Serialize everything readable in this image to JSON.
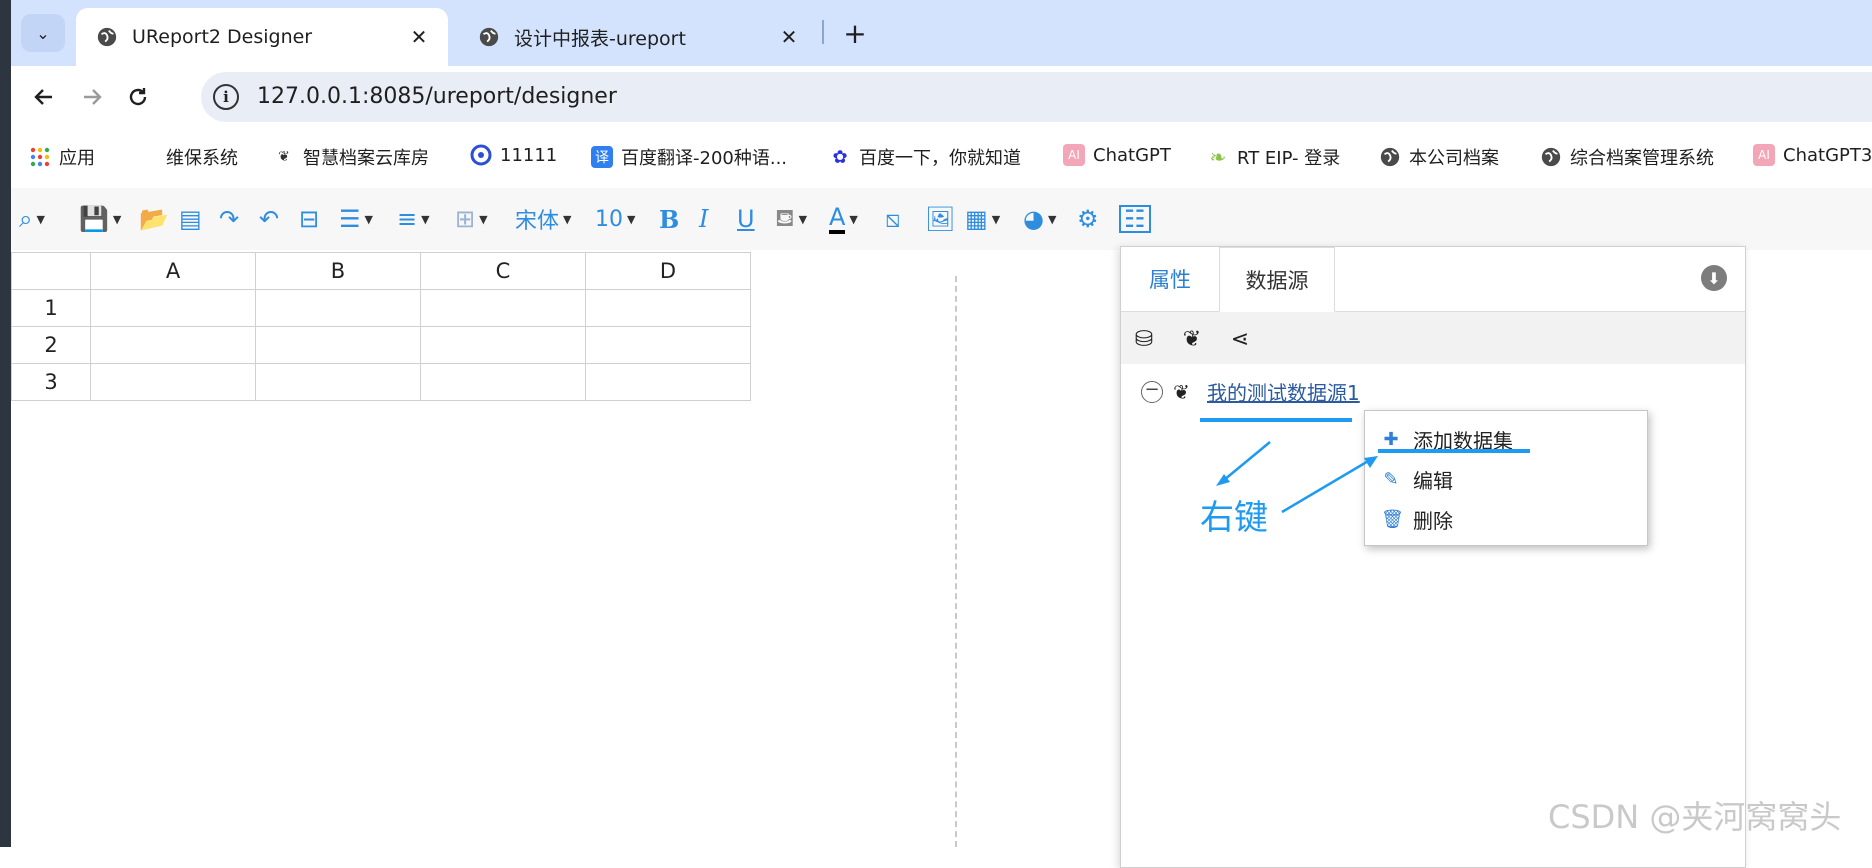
{
  "browser": {
    "tabs": [
      {
        "title": "UReport2 Designer",
        "active": true
      },
      {
        "title": "设计中报表-ureport",
        "active": false
      }
    ],
    "close_glyph": "✕",
    "new_tab_glyph": "+",
    "url": "127.0.0.1:8085/ureport/designer",
    "info_glyph": "i"
  },
  "bookmarks": [
    {
      "label": "应用",
      "icon": "apps-grid-icon"
    },
    {
      "label": "维保系统",
      "icon": "none"
    },
    {
      "label": "智慧档案云库房",
      "icon": "lotus-icon"
    },
    {
      "label": "11111",
      "icon": "target-icon"
    },
    {
      "label": "百度翻译-200种语...",
      "icon": "translate-icon",
      "glyph": "译"
    },
    {
      "label": "百度一下，你就知道",
      "icon": "baidu-paw-icon"
    },
    {
      "label": "ChatGPT",
      "icon": "ai-icon",
      "glyph": "AI"
    },
    {
      "label": "RT EIP- 登录",
      "icon": "leaf-icon"
    },
    {
      "label": "本公司档案",
      "icon": "globe-icon"
    },
    {
      "label": "综合档案管理系统",
      "icon": "globe-icon"
    },
    {
      "label": "ChatGPT3",
      "icon": "ai-icon",
      "glyph": "AI"
    }
  ],
  "toolbar": {
    "font_name": "宋体",
    "font_size": "10",
    "bold": "B",
    "italic": "I",
    "underline": "U",
    "font_color": "A"
  },
  "grid": {
    "columns": [
      "A",
      "B",
      "C",
      "D"
    ],
    "rows": [
      "1",
      "2",
      "3"
    ]
  },
  "panel": {
    "tabs": [
      "属性",
      "数据源"
    ],
    "active_tab": "数据源",
    "tree": {
      "datasource": "我的测试数据源1",
      "toggle": "−"
    }
  },
  "context_menu": {
    "items": [
      {
        "label": "添加数据集",
        "icon": "plus-icon",
        "glyph": "✚"
      },
      {
        "label": "编辑",
        "icon": "edit-icon",
        "glyph": "✎"
      },
      {
        "label": "删除",
        "icon": "trash-icon",
        "glyph": "🗑"
      }
    ]
  },
  "annotation": {
    "label": "右键",
    "color": "#1e9af0"
  },
  "watermark": "CSDN @夹河窝窝头",
  "colors": {
    "tabstrip": "#d3e3fd",
    "toolbar_icon": "#2f8de0",
    "link": "#2c5aa0"
  }
}
